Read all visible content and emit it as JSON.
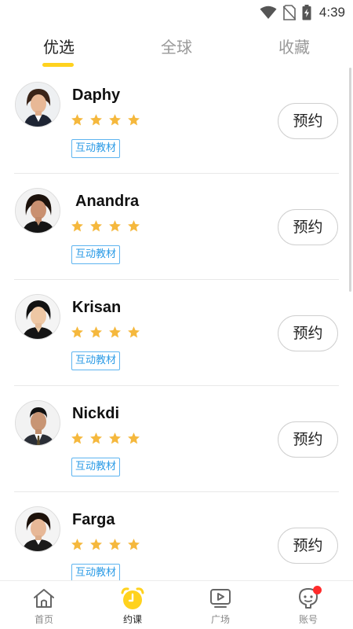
{
  "status_bar": {
    "time": "4:39",
    "icons": [
      "wifi-icon",
      "no-sim-icon",
      "battery-charging-icon"
    ]
  },
  "tabs": [
    {
      "label": "优选",
      "active": true
    },
    {
      "label": "全球",
      "active": false
    },
    {
      "label": "收藏",
      "active": false
    }
  ],
  "colors": {
    "accent": "#FFD21E",
    "star": "#F5B83D",
    "tag_border": "#5db4f0",
    "tag_text": "#2b9be6",
    "badge": "#ff2b2b"
  },
  "teachers": [
    {
      "name": "Daphy",
      "rating": 4,
      "tag": "互动教材",
      "button": "预约",
      "avatar": "female-teacher-avatar"
    },
    {
      "name": "Anandra",
      "rating": 4,
      "tag": "互动教材",
      "button": "预约",
      "avatar": "female-teacher-avatar"
    },
    {
      "name": "Krisan",
      "rating": 4,
      "tag": "互动教材",
      "button": "预约",
      "avatar": "female-teacher-avatar"
    },
    {
      "name": "Nickdi",
      "rating": 4,
      "tag": "互动教材",
      "button": "预约",
      "avatar": "male-teacher-avatar"
    },
    {
      "name": "Farga",
      "rating": 4,
      "tag": "互动教材",
      "button": "预约",
      "avatar": "female-teacher-avatar"
    }
  ],
  "bottom_nav": [
    {
      "label": "首页",
      "icon": "home-icon",
      "active": false
    },
    {
      "label": "约课",
      "icon": "alarm-clock-icon",
      "active": true
    },
    {
      "label": "广场",
      "icon": "video-play-icon",
      "active": false
    },
    {
      "label": "账号",
      "icon": "account-icon",
      "active": false,
      "badge": true
    }
  ]
}
